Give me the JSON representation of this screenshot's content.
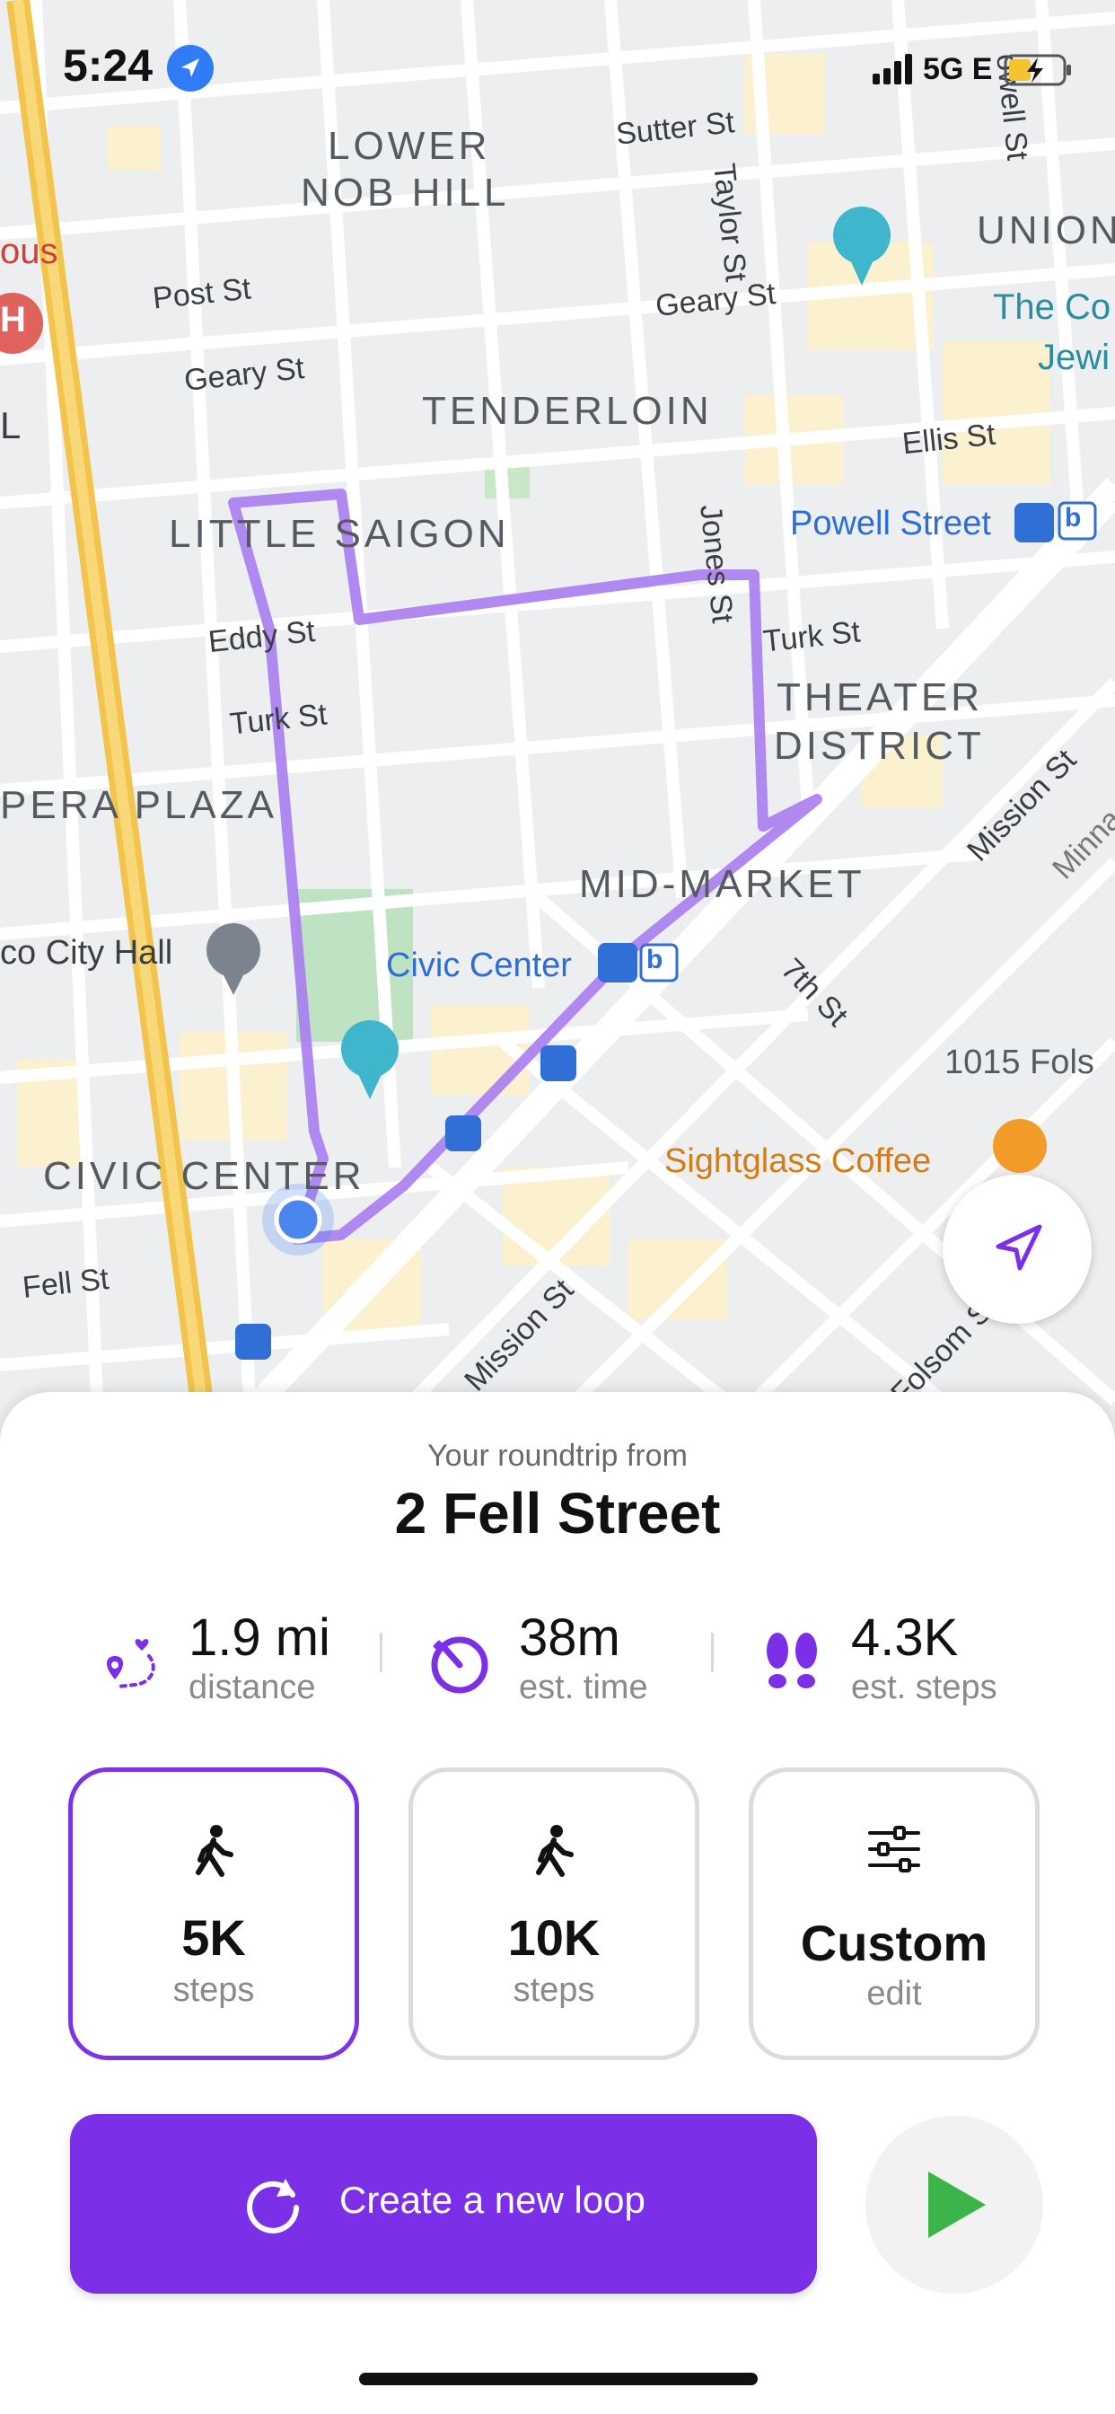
{
  "status_bar": {
    "time": "5:24",
    "network": "5G E"
  },
  "map": {
    "neighborhoods": {
      "lower": "LOWER",
      "nob_hill": "NOB HILL",
      "tenderloin": "TENDERLOIN",
      "little_saigon": "LITTLE SAIGON",
      "theater": "THEATER",
      "district": "DISTRICT",
      "opera_plaza": "PERA PLAZA",
      "mid_market": "MID-MARKET",
      "civic_center": "CIVIC CENTER",
      "union": "UNION"
    },
    "streets": {
      "sutter": "Sutter St",
      "taylor": "Taylor St",
      "powell": "owell St",
      "post": "Post St",
      "geary_left": "Geary St",
      "geary_right": "Geary St",
      "ellis": "Ellis St",
      "eddy": "Eddy St",
      "turk_left": "Turk St",
      "turk_right": "Turk St",
      "jones": "Jones St",
      "mission_top": "Mission St",
      "minna": "Minna",
      "seventh": "7th St",
      "mission_bottom": "Mission St",
      "fell": "Fell St",
      "folsom": "Folsom S"
    },
    "pois": {
      "powell_station": "Powell Street",
      "civic_station": "Civic Center",
      "city_hall": "co City Hall",
      "sightglass": "Sightglass Coffee",
      "fols": "1015 Fols",
      "the_co": "The Co",
      "jewi": "Jewi",
      "ous": "ous",
      "h_badge": "H",
      "l_edge": "L",
      "bart": "b"
    }
  },
  "sheet": {
    "subtitle": "Your roundtrip from",
    "title": "2 Fell Street",
    "stats": [
      {
        "value": "1.9 mi",
        "label": "distance",
        "icon": "route-pin-icon"
      },
      {
        "value": "38m",
        "label": "est. time",
        "icon": "timer-icon"
      },
      {
        "value": "4.3K",
        "label": "est. steps",
        "icon": "footprints-icon"
      }
    ],
    "options": [
      {
        "number": "5K",
        "unit": "steps",
        "icon": "walking-icon",
        "selected": true
      },
      {
        "number": "10K",
        "unit": "steps",
        "icon": "walking-icon",
        "selected": false
      },
      {
        "number": "Custom",
        "unit": "edit",
        "icon": "sliders-icon",
        "selected": false
      }
    ],
    "create_label": "Create a new loop"
  },
  "colors": {
    "accent": "#7b2fe6",
    "route": "#a97cf0",
    "start_button": "#3bb54a",
    "user_dot": "#4a86ee"
  }
}
